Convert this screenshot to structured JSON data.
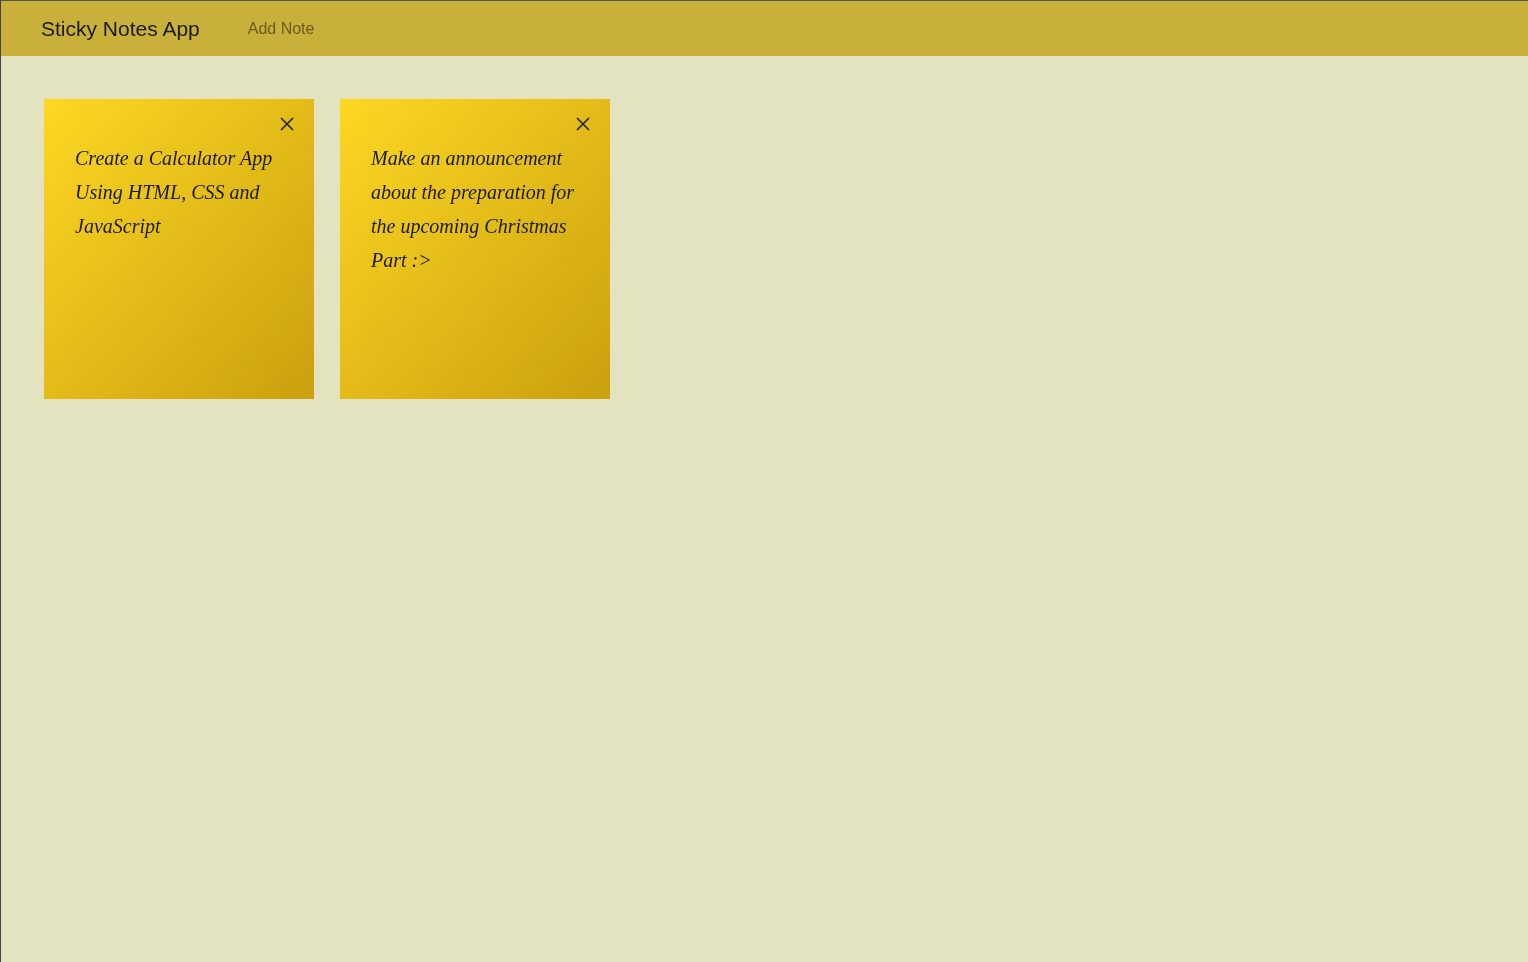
{
  "header": {
    "title": "Sticky Notes App",
    "nav": [
      {
        "label": "Add Note"
      }
    ]
  },
  "notes": [
    {
      "text": "Create a Calculator App Using HTML, CSS and JavaScript"
    },
    {
      "text": "Make an announcement about the preparation for the upcoming Christmas Part :>"
    }
  ]
}
